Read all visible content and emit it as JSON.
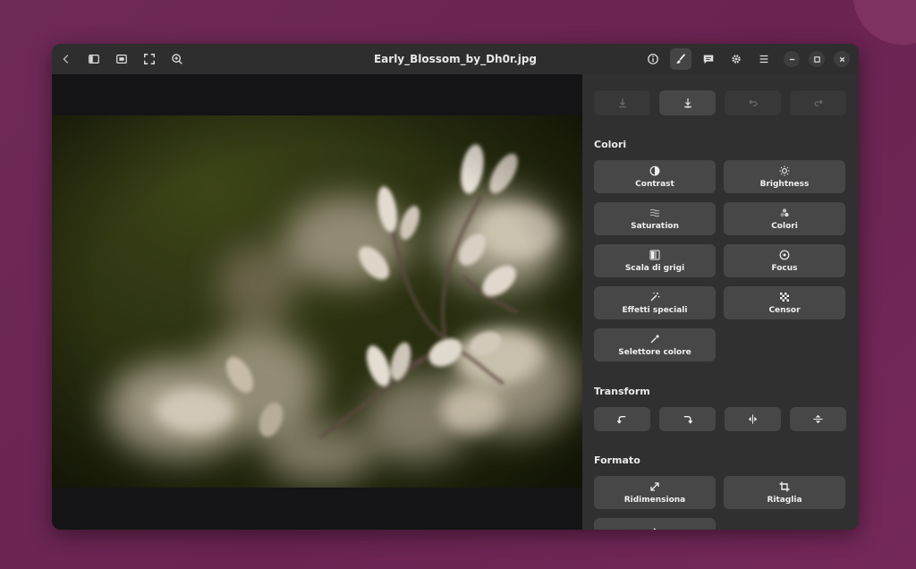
{
  "window": {
    "title": "Early_Blossom_by_Dh0r.jpg"
  },
  "headerbar": {
    "left_icons": [
      "back-icon",
      "sidebar-icon",
      "fit-window-icon",
      "fullscreen-icon",
      "zoom-in-icon"
    ],
    "right_icons": [
      "info-icon",
      "edit-brush-icon",
      "comment-icon",
      "settings-icon",
      "menu-icon"
    ],
    "window_controls": [
      "minimize-icon",
      "maximize-icon",
      "close-icon"
    ]
  },
  "panel": {
    "history_icons": [
      "save-icon",
      "save-as-icon",
      "undo-icon",
      "redo-icon"
    ],
    "colors": {
      "title": "Colori",
      "tools": [
        {
          "label": "Contrast",
          "icon": "contrast-icon"
        },
        {
          "label": "Brightness",
          "icon": "brightness-icon"
        },
        {
          "label": "Saturation",
          "icon": "saturation-icon"
        },
        {
          "label": "Colori",
          "icon": "colors-icon"
        },
        {
          "label": "Scala di grigi",
          "icon": "grayscale-icon"
        },
        {
          "label": "Focus",
          "icon": "focus-icon"
        },
        {
          "label": "Effetti speciali",
          "icon": "effects-icon"
        },
        {
          "label": "Censor",
          "icon": "censor-icon"
        },
        {
          "label": "Selettore colore",
          "icon": "color-picker-icon"
        }
      ]
    },
    "transform": {
      "title": "Transform",
      "tools": [
        "rotate-left-icon",
        "rotate-right-icon",
        "flip-horizontal-icon",
        "flip-vertical-icon"
      ]
    },
    "format": {
      "title": "Formato",
      "tools": [
        {
          "label": "Ridimensiona",
          "icon": "resize-icon"
        },
        {
          "label": "Ritaglia",
          "icon": "crop-icon"
        }
      ]
    }
  },
  "colors": {
    "accent": "#6e2a57",
    "panel": "#303030",
    "tile": "#474747"
  }
}
